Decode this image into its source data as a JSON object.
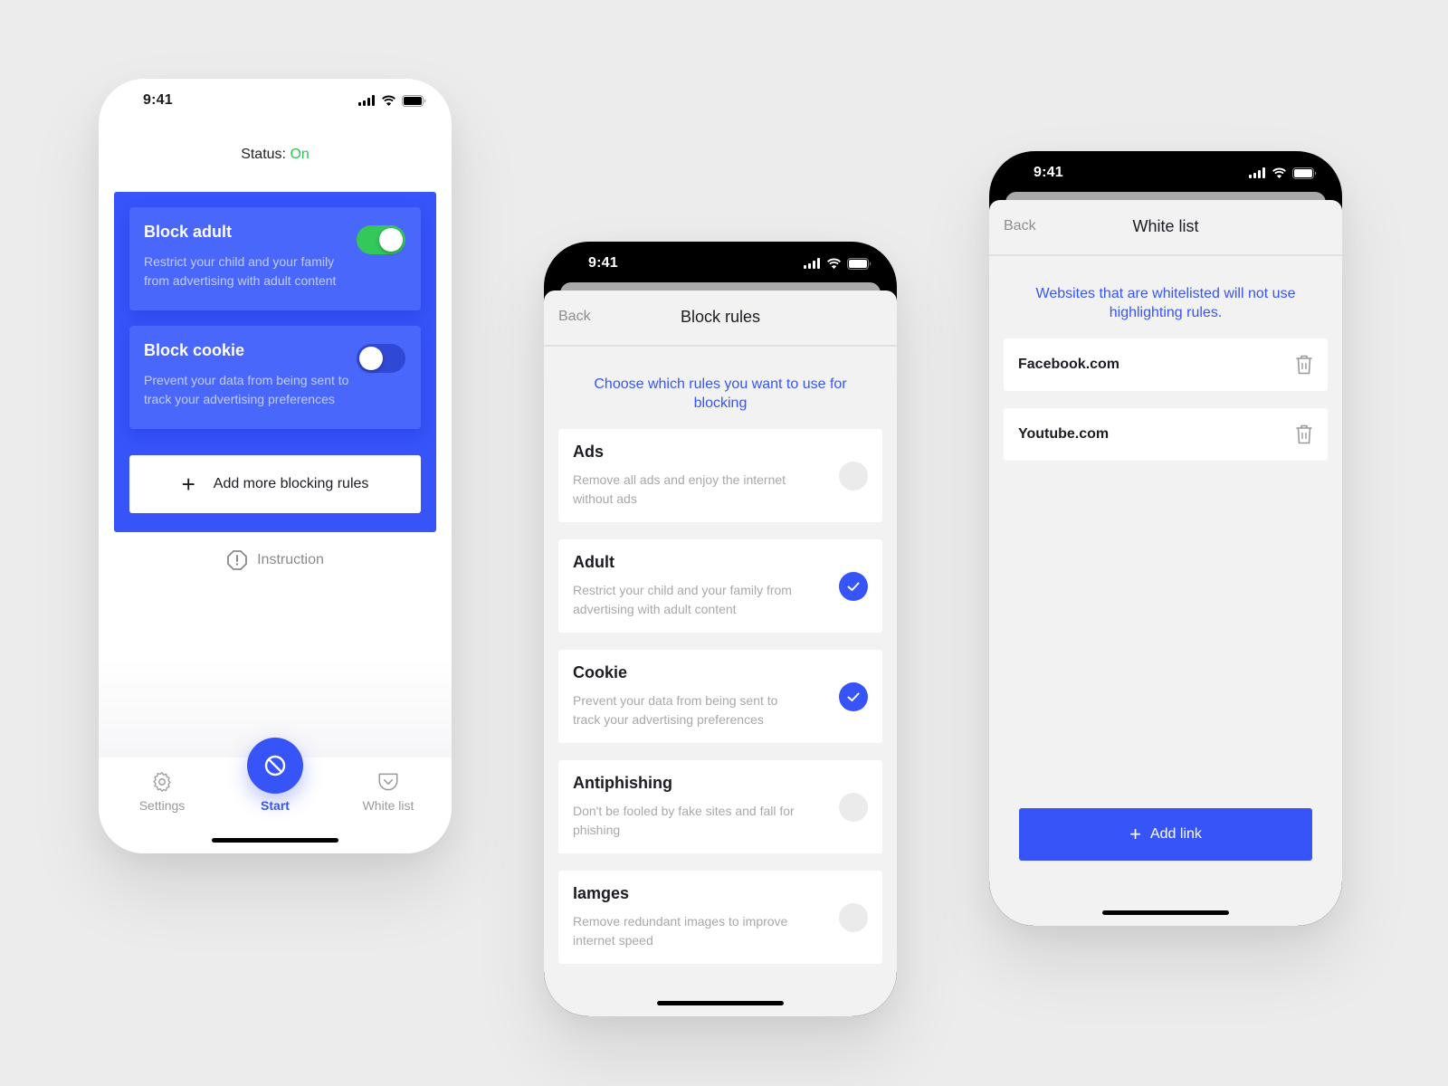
{
  "status_bar": {
    "time": "9:41"
  },
  "home_screen": {
    "status_label": "Status:",
    "status_value": "On",
    "status_color": "#2fc25b",
    "accent": "#3754f9",
    "rules": [
      {
        "title": "Block adult",
        "description": "Restrict your child and your family from advertising with adult content",
        "enabled": true
      },
      {
        "title": "Block cookie",
        "description": "Prevent your data from being sent to track your advertising preferences",
        "enabled": false
      }
    ],
    "add_rules_label": "Add more blocking rules",
    "instruction_label": "Instruction",
    "tabs": [
      {
        "label": "Settings",
        "icon": "gear-icon",
        "active": false
      },
      {
        "label": "Start",
        "icon": "block-icon",
        "active": true
      },
      {
        "label": "White list",
        "icon": "pocket-icon",
        "active": false
      }
    ]
  },
  "block_rules_screen": {
    "back_label": "Back",
    "title": "Block rules",
    "hint": "Choose which rules you want to use for blocking",
    "items": [
      {
        "name": "Ads",
        "description": "Remove all ads and enjoy the internet without ads",
        "checked": false
      },
      {
        "name": "Adult",
        "description": "Restrict your child and your family from advertising with adult content",
        "checked": true
      },
      {
        "name": "Cookie",
        "description": "Prevent your data from being sent to track your advertising preferences",
        "checked": true
      },
      {
        "name": "Antiphishing",
        "description": "Don't be fooled by fake sites and fall for phishing",
        "checked": false
      },
      {
        "name": "Iamges",
        "description": "Remove redundant images to improve internet speed",
        "checked": false
      }
    ]
  },
  "white_list_screen": {
    "back_label": "Back",
    "title": "White list",
    "hint": "Websites that are whitelisted will not use highlighting rules.",
    "sites": [
      {
        "name": "Facebook.com"
      },
      {
        "name": "Youtube.com"
      }
    ],
    "add_link_label": "Add link"
  }
}
